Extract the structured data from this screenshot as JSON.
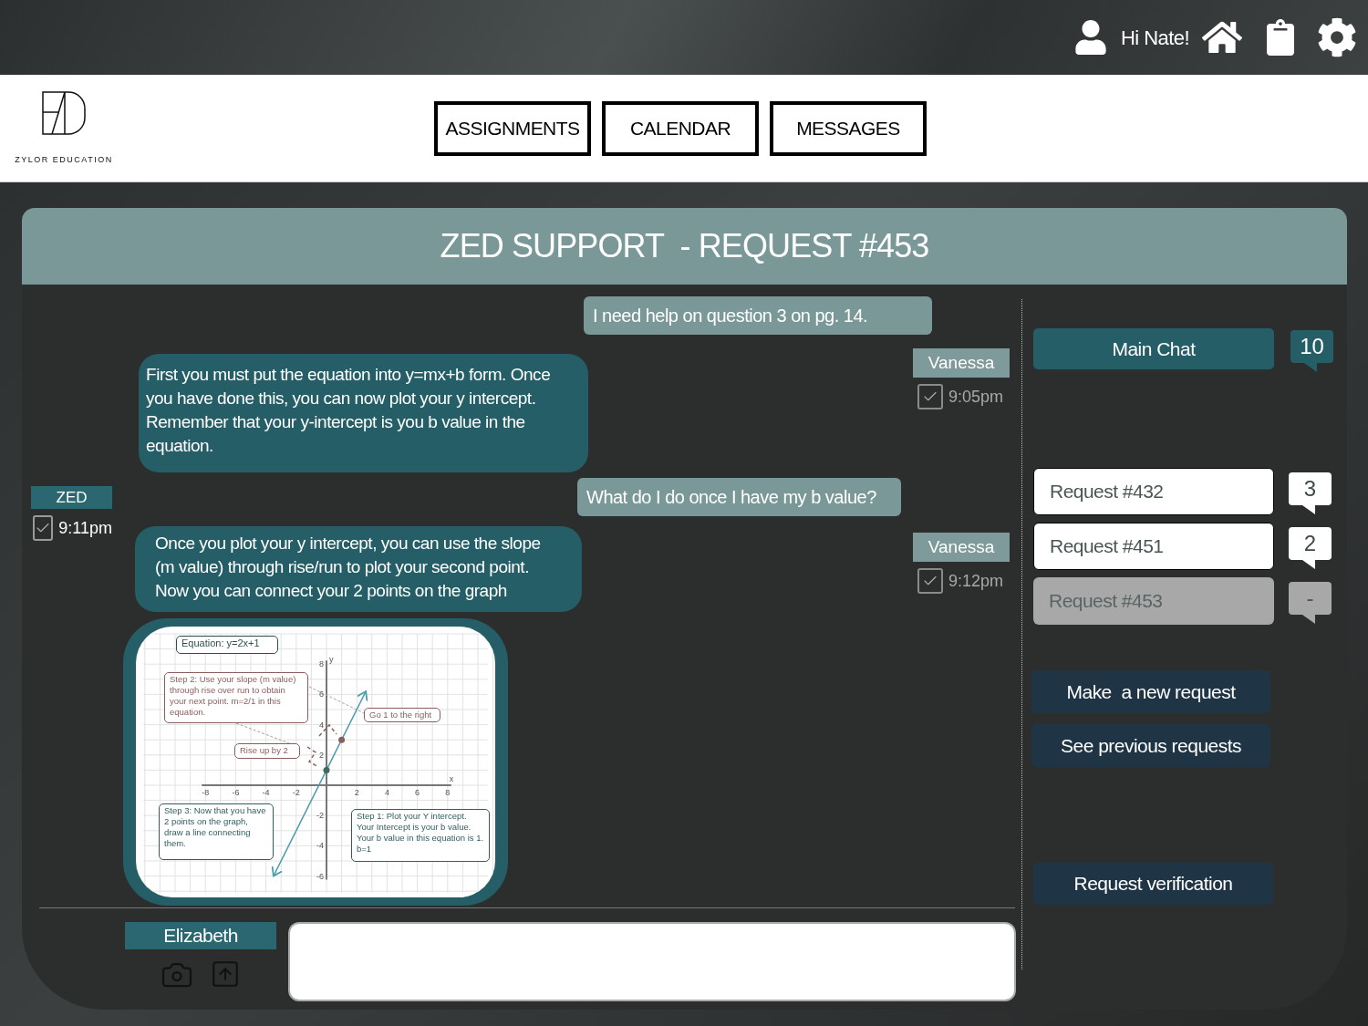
{
  "top_bar": {
    "greeting": "Hi Nate!"
  },
  "logo": {
    "caption": "ZYLOR EDUCATION"
  },
  "nav_buttons": [
    "ASSIGNMENTS",
    "CALENDAR",
    "MESSAGES"
  ],
  "panel": {
    "title": "ZED SUPPORT  - REQUEST #453"
  },
  "chat": [
    {
      "kind": "student",
      "text": "I need help on question 3 on pg. 14.",
      "sender": "Vanessa",
      "time": "9:05pm",
      "checked": true
    },
    {
      "kind": "support",
      "text": "First you must put the equation into y=mx+b form. Once you have done this, you can now plot your y intercept. Remember that your y-intercept is you b value in the equation."
    },
    {
      "kind": "sender_tag",
      "sender": "ZED",
      "time": "9:11pm",
      "checked": true
    },
    {
      "kind": "student",
      "text": "What do I do once I have my b value?",
      "sender": "Vanessa",
      "time": "9:12pm",
      "checked": true
    },
    {
      "kind": "support",
      "text": "Once you plot your y intercept, you can use the slope (m value) through rise/run to plot your second point. Now you can connect your 2 points on the graph"
    },
    {
      "kind": "graph",
      "chart_data": {
        "type": "line",
        "xlabel": "x",
        "ylabel": "y",
        "xlim": [
          -8,
          8
        ],
        "ylim": [
          -6,
          8
        ],
        "xticks": [
          -8,
          -6,
          -4,
          -2,
          2,
          4,
          6,
          8
        ],
        "yticks": [
          -6,
          -4,
          -2,
          2,
          4,
          6,
          8
        ],
        "grid": true,
        "series": [
          {
            "color": "#4a9fad",
            "marker": "circle",
            "x": [
              -3.5,
              0,
              1,
              2.6
            ],
            "values": [
              -6,
              1,
              3,
              6.2
            ]
          }
        ],
        "annotations": [
          {
            "text": "Equation: y=2x+1"
          },
          {
            "text": "Step 2: Use your slope (m value) through rise over run to obtain your next point. m=2/1 in this equation."
          },
          {
            "text": "Go 1 to the right"
          },
          {
            "text": "Rise up by 2"
          },
          {
            "text": "Step 3: Now that you have 2 points on the graph, draw a line connecting them."
          },
          {
            "text": "Step 1: Plot your Y intercept. Your Intercept is your b value. Your b value in this equation is 1. b=1"
          }
        ]
      }
    }
  ],
  "composer": {
    "sender": "Elizabeth"
  },
  "sidebar": {
    "main_chat": {
      "label": "Main Chat",
      "count": "10"
    },
    "requests": [
      {
        "label": "Request #432",
        "count": "3",
        "selected": false
      },
      {
        "label": "Request #451",
        "count": "2",
        "selected": false
      },
      {
        "label": "Request #453",
        "count": "-",
        "selected": true
      }
    ],
    "actions": [
      "Make  a new request",
      "See previous requests"
    ],
    "verify": "Request verification"
  }
}
